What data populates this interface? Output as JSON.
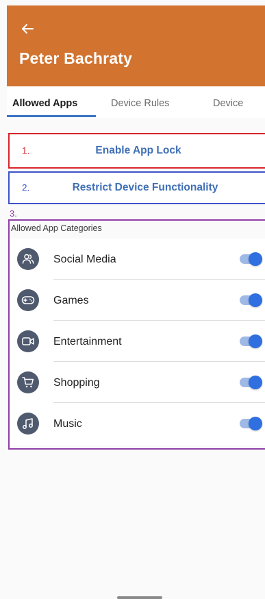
{
  "header": {
    "back_icon": "arrow-left-icon",
    "title": "Peter Bachraty",
    "background_color": "#d2732f"
  },
  "tabs": [
    {
      "label": "Allowed Apps",
      "active": true
    },
    {
      "label": "Device Rules",
      "active": false
    },
    {
      "label": "Device",
      "active": false
    }
  ],
  "accent_color": "#3a72c4",
  "actions": {
    "app_lock": {
      "marker": "1.",
      "label": "Enable App Lock",
      "border_color": "#d6252a"
    },
    "restrict": {
      "marker": "2.",
      "label": "Restrict Device Functionality",
      "border_color": "#3d54c8"
    }
  },
  "categories_section": {
    "marker": "3.",
    "border_color": "#8e3fa7",
    "heading": "Allowed App Categories",
    "items": [
      {
        "label": "Social Media",
        "icon": "people-icon",
        "enabled": true
      },
      {
        "label": "Games",
        "icon": "gamepad-icon",
        "enabled": true
      },
      {
        "label": "Entertainment",
        "icon": "video-camera-icon",
        "enabled": true
      },
      {
        "label": "Shopping",
        "icon": "shopping-cart-icon",
        "enabled": true
      },
      {
        "label": "Music",
        "icon": "music-note-icon",
        "enabled": true
      }
    ]
  }
}
